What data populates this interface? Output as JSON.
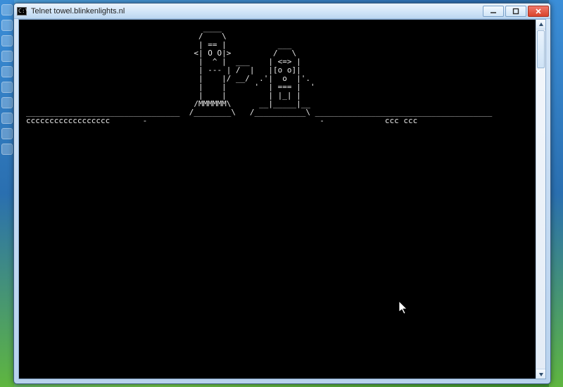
{
  "window": {
    "title": "Telnet towel.blinkenlights.nl",
    "icon_name": "cmd-prompt-icon",
    "buttons": {
      "minimize_glyph": "–",
      "maximize_glyph": "□",
      "close_glyph": "✕"
    }
  },
  "colors": {
    "terminal_bg": "#000000",
    "terminal_fg": "#e8e8e8",
    "chrome_light": "#eaf3fc",
    "chrome_dark": "#bdd7f0",
    "close_red": "#d9432b"
  },
  "terminal": {
    "ascii_art": "                                      ____\n                                     /    \\\n                                     | == |           ___\n                                    <| O O|>         /   \\\n                                     |  ^ |  ___    | <=> |\n                                     | --- | /  |   |[o o]|\n                                     |    |/ __/  .'|  o  |'.\n                                     |    |      '  | === |  '\n                                     |    |         | |_| |\n                                    /MMMMMM\\      __|_____|__\n_________________________________  /________\\   /___________\\ ______________________________________\ncccccccccccccccccc       -                                     -             ccc ccc"
  }
}
